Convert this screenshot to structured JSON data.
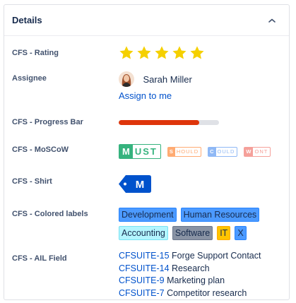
{
  "panel": {
    "title": "Details"
  },
  "fields": {
    "rating": {
      "label": "CFS - Rating",
      "value": 5,
      "max": 5,
      "star_color": "#f5d000"
    },
    "assignee": {
      "label": "Assignee",
      "name": "Sarah Miller",
      "assign_link": "Assign to me"
    },
    "progress": {
      "label": "CFS - Progress Bar",
      "value_fraction": 0.8,
      "fill_color": "#de350b"
    },
    "moscow": {
      "label": "CFS - MoSCoW",
      "selected": "MUST",
      "options": [
        {
          "first": "M",
          "rest": "UST",
          "color": "#36b37e"
        },
        {
          "first": "S",
          "rest": "HOULD",
          "color": "#ffab73"
        },
        {
          "first": "C",
          "rest": "OULD",
          "color": "#8fb8f5"
        },
        {
          "first": "W",
          "rest": "ONT",
          "color": "#f5a09a"
        }
      ]
    },
    "shirt": {
      "label": "CFS - Shirt",
      "value": "M",
      "color": "#0052cc"
    },
    "colored_labels": {
      "label": "CFS - Colored labels",
      "items": [
        {
          "text": "Development",
          "bg": "#4c9aff",
          "border": "#2684ff"
        },
        {
          "text": "Human Resources",
          "bg": "#4c9aff",
          "border": "#2684ff"
        },
        {
          "text": "Accounting",
          "bg": "#b3f5ff",
          "border": "#79e2f2"
        },
        {
          "text": "Software",
          "bg": "#8993a4",
          "border": "#6b778c"
        },
        {
          "text": "IT",
          "bg": "#ffc400",
          "border": "#ffab00"
        },
        {
          "text": "X",
          "bg": "#4c9aff",
          "border": "#2684ff"
        }
      ]
    },
    "ail": {
      "label": "CFS - AIL Field",
      "items": [
        {
          "key": "CFSUITE-15",
          "summary": "Forge Support Contact"
        },
        {
          "key": "CFSUITE-14",
          "summary": "Research"
        },
        {
          "key": "CFSUITE-9",
          "summary": "Marketing plan"
        },
        {
          "key": "CFSUITE-7",
          "summary": "Competitor research"
        }
      ]
    }
  }
}
